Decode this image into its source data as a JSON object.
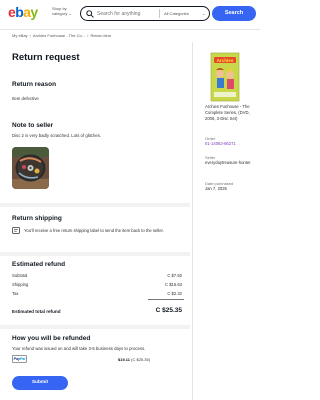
{
  "header": {
    "logo": {
      "e": "e",
      "b": "b",
      "a": "a",
      "y": "y"
    },
    "shop_by_category": [
      "Shop by",
      "category"
    ],
    "search_placeholder": "Search for anything",
    "category_select": "All Categories",
    "search_button": "Search"
  },
  "breadcrumb": [
    "My eBay",
    "Archies Funhouse - The Co...",
    "Return item"
  ],
  "page_title": "Return request",
  "return_reason": {
    "heading": "Return reason",
    "value": "Item defective"
  },
  "note_to_seller": {
    "heading": "Note to seller",
    "value": "Disc 2 is very badly scratched. Lots of glitches."
  },
  "return_shipping": {
    "heading": "Return shipping",
    "text": "You'll receive a free return shipping label to send the item back to the seller."
  },
  "estimated_refund": {
    "heading": "Estimated refund",
    "rows": [
      {
        "label": "Subtotal",
        "value": "C $7.50"
      },
      {
        "label": "Shipping",
        "value": "C $15.63"
      },
      {
        "label": "Tax",
        "value": "C $2.32"
      }
    ],
    "total_label": "Estimated total refund",
    "total_value": "C $25.35"
  },
  "refund_method": {
    "heading": "How you will be refunded",
    "text": "Your refund was issued on and will take 3-5 business days to process.",
    "paypal_logo": {
      "p1": "Pay",
      "p2": "Pal"
    },
    "amount_bold": "$19.11",
    "amount_rest": "(C $25.35)"
  },
  "submit_button": "Submit",
  "item_panel": {
    "title": "Archies Funhouse - The Complete Series, (DVD, 2006, 3-Disc Set)",
    "order_label": "Order",
    "order_value": "01-14063-66271",
    "seller_label": "Seller",
    "seller_value": "everydaytreasure-hunter",
    "date_label": "Date purchased",
    "date_value": "Jan 7, 2026"
  },
  "colors": {
    "accent": "#3665f3",
    "link": "#7a3bbf"
  }
}
